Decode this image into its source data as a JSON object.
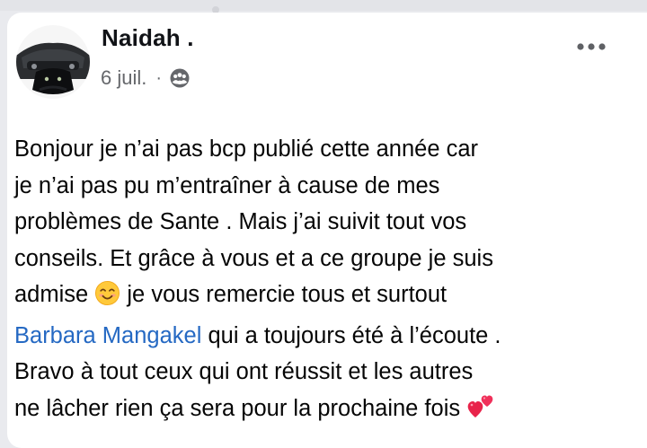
{
  "post": {
    "author": {
      "name": "Naidah ."
    },
    "timestamp": "6 juil.",
    "separator": "·",
    "audience_icon": "group-audience-icon",
    "more_icon": "more-options-icon",
    "body": {
      "line1": "Bonjour je n’ai pas bcp publié cette année car",
      "line2": "je n’ai pas pu m’entraîner à cause de mes",
      "line3": "problèmes de Sante . Mais j’ai suivit tout vos",
      "line4": "conseils. Et grâce à vous et a ce groupe je suis",
      "line5_before_emoji": "admise",
      "line5_after_emoji": "je vous remercie tous et surtout",
      "mention": "Barbara Mangakel",
      "line6_after_mention": "qui a toujours été à l’écoute .",
      "line7": "Bravo à tout ceux qui ont réussit et  les autres",
      "line8": "ne lâcher rien ça sera pour la prochaine fois",
      "emoji_smile": "smiling-face-emoji",
      "emoji_hearts": "two-hearts-emoji"
    }
  },
  "colors": {
    "mention": "#2569c3",
    "meta_text": "#65676b",
    "text": "#050505",
    "background": "#e9eaee",
    "card": "#ffffff"
  }
}
